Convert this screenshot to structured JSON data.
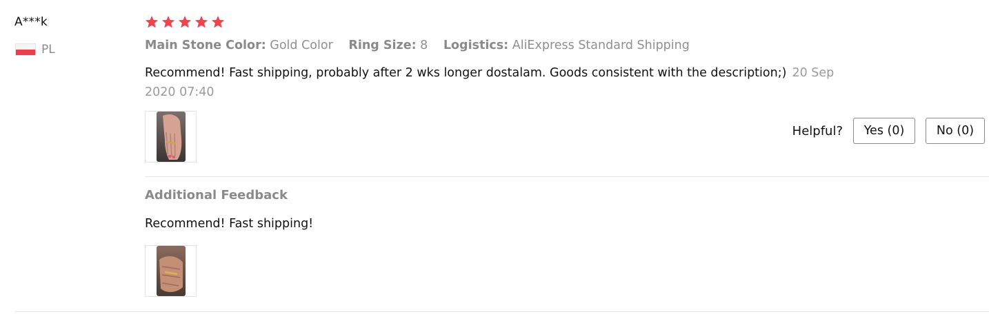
{
  "user": {
    "name": "A***k",
    "country_code": "PL",
    "flag_icon": "poland-flag-icon"
  },
  "review": {
    "rating": 5,
    "rating_max": 5,
    "star_color": "#f0444c",
    "attributes": [
      {
        "key": "Main Stone Color:",
        "value": "Gold Color"
      },
      {
        "key": "Ring Size:",
        "value": "8"
      },
      {
        "key": "Logistics:",
        "value": "AliExpress Standard Shipping"
      }
    ],
    "text": "Recommend! Fast shipping, probably after 2 wks longer dostalam. Goods consistent with the description;)",
    "date": "20 Sep 2020 07:40",
    "photo_icon": "review-photo-hand-ring"
  },
  "helpful": {
    "label": "Helpful?",
    "yes_label": "Yes (0)",
    "no_label": "No (0)"
  },
  "additional": {
    "title": "Additional Feedback",
    "text": "Recommend! Fast shipping!",
    "photo_icon": "additional-photo-hand-ring"
  }
}
